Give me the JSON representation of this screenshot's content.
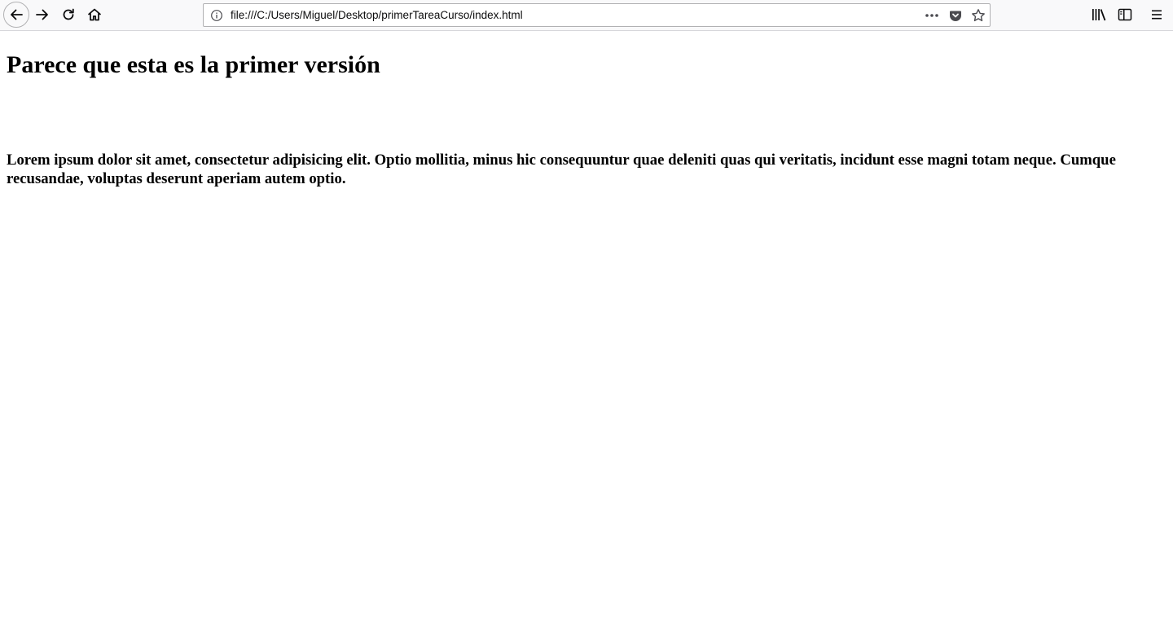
{
  "browser": {
    "url": "file:///C:/Users/Miguel/Desktop/primerTareaCurso/index.html",
    "nav_icons": [
      "back-arrow-icon",
      "forward-arrow-icon",
      "reload-icon",
      "home-icon"
    ],
    "url_icons": [
      "info-icon",
      "more-dots-icon",
      "pocket-icon",
      "bookmark-star-icon"
    ],
    "toolbar_icons": [
      "library-icon",
      "sidebar-icon",
      "hamburger-menu-icon"
    ]
  },
  "page": {
    "heading": "Parece que esta es la primer versión",
    "paragraph": "Lorem ipsum dolor sit amet, consectetur adipisicing elit. Optio mollitia, minus hic consequuntur quae deleniti quas qui veritatis, incidunt esse magni totam neque. Cumque recusandae, voluptas deserunt aperiam autem optio."
  }
}
